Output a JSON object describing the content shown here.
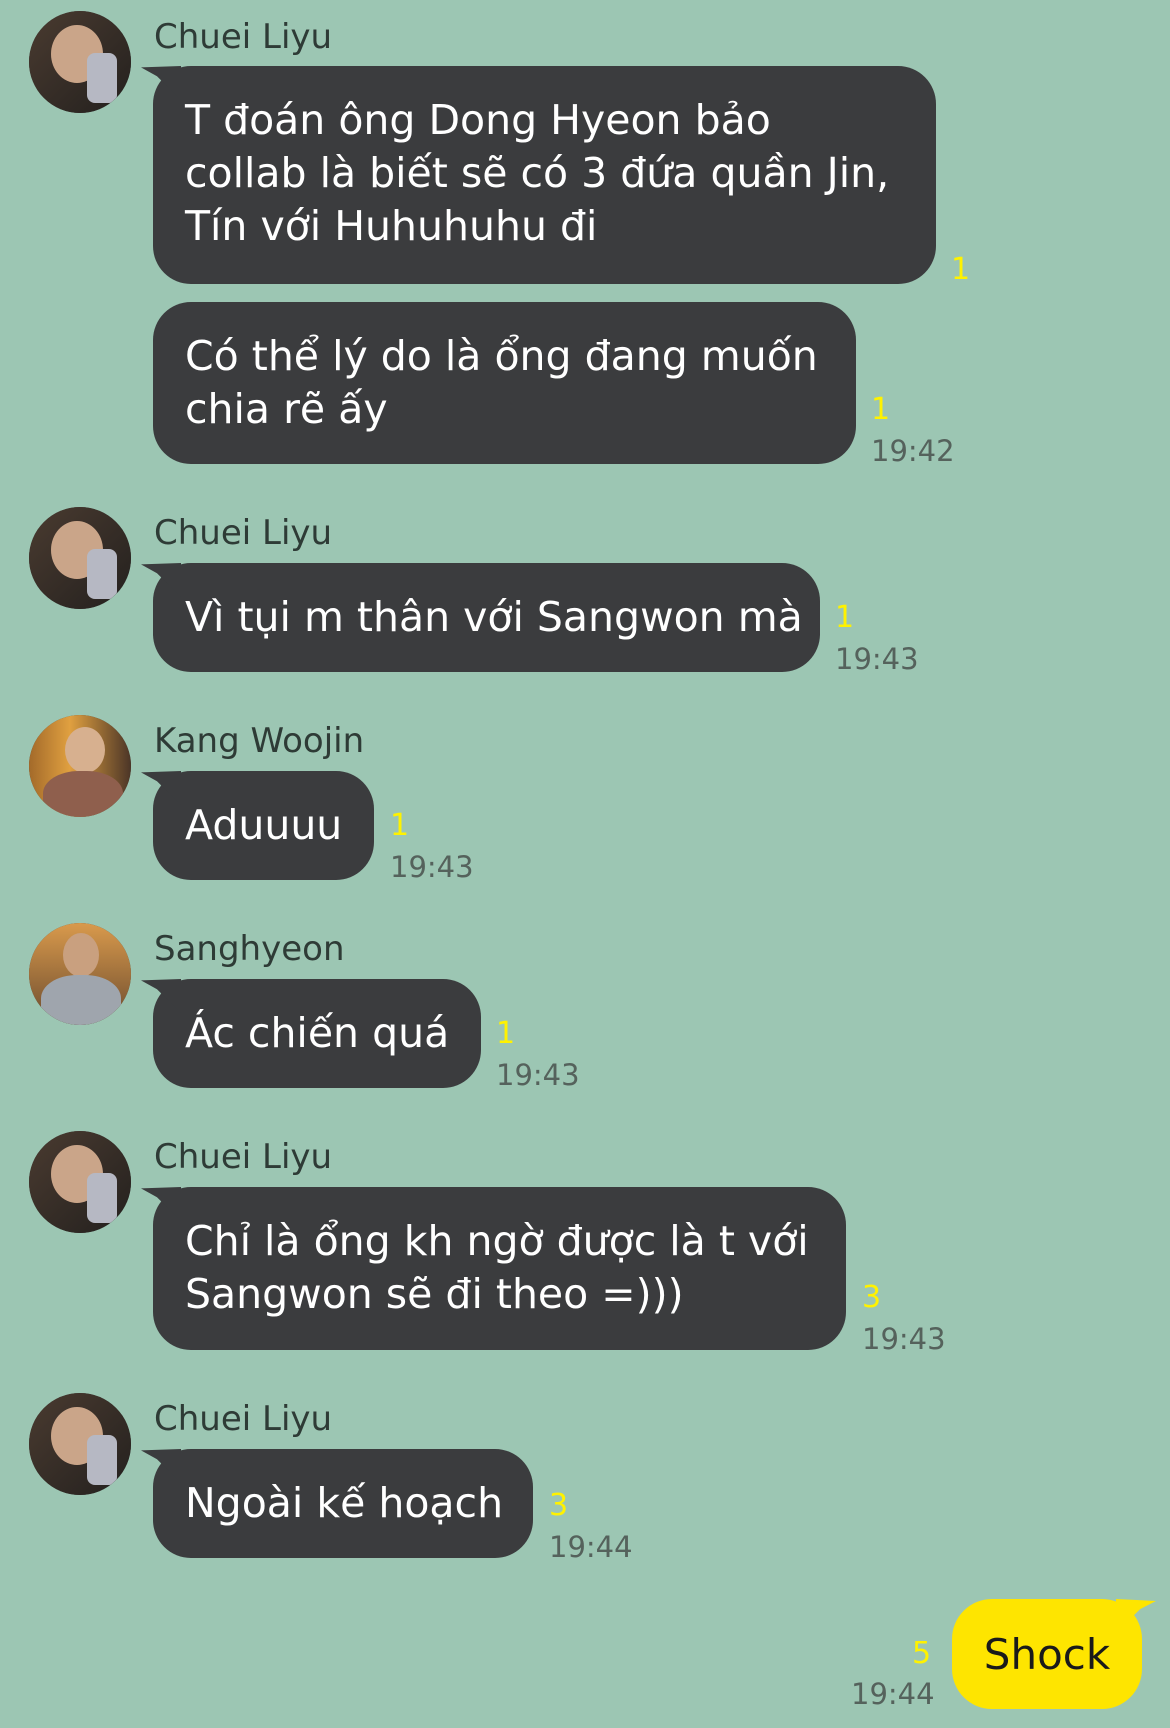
{
  "messages": [
    {
      "sender": "Chuei Liyu",
      "lines": [
        "T đoán ông Dong Hyeon bảo",
        "collab là biết sẽ có 3 đứa quần Jin,",
        "Tín với Huhuhuhu đi"
      ],
      "unread": "1",
      "time": ""
    },
    {
      "sender": "",
      "lines": [
        "Có thể lý do là ổng đang muốn",
        "chia rẽ ấy"
      ],
      "unread": "1",
      "time": "19:42"
    },
    {
      "sender": "Chuei Liyu",
      "lines": [
        "Vì tụi m thân với Sangwon mà"
      ],
      "unread": "1",
      "time": "19:43"
    },
    {
      "sender": "Kang Woojin",
      "lines": [
        "Aduuuu"
      ],
      "unread": "1",
      "time": "19:43"
    },
    {
      "sender": "Sanghyeon",
      "lines": [
        "Ác chiến quá"
      ],
      "unread": "1",
      "time": "19:43"
    },
    {
      "sender": "Chuei Liyu",
      "lines": [
        "Chỉ là ổng kh ngờ được là t với",
        "Sangwon sẽ đi theo =)))"
      ],
      "unread": "3",
      "time": "19:43"
    },
    {
      "sender": "Chuei Liyu",
      "lines": [
        "Ngoài kế hoạch"
      ],
      "unread": "3",
      "time": "19:44"
    }
  ],
  "my_message": {
    "text": "Shock",
    "unread": "5",
    "time": "19:44"
  },
  "colors": {
    "background": "#9cc6b3",
    "bubble": "#3b3c3e",
    "my_bubble": "#fee500",
    "unread": "#fff200"
  }
}
